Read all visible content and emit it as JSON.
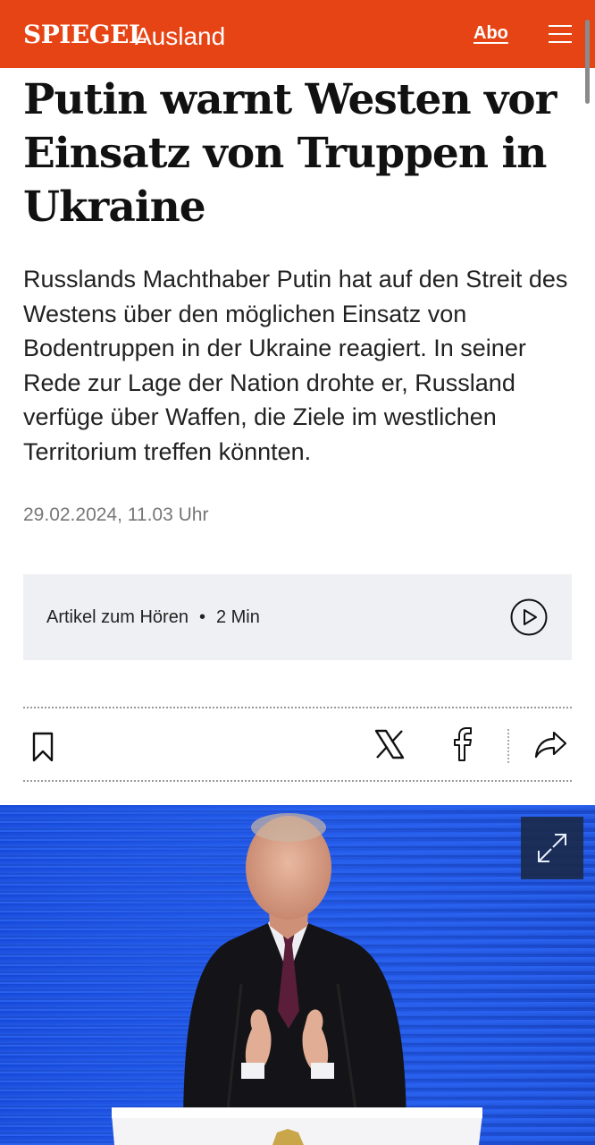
{
  "header": {
    "brand": "SPIEGEL",
    "section": "Ausland",
    "abo_label": "Abo",
    "menu_icon": "hamburger-menu-icon",
    "background": "#e64415"
  },
  "article": {
    "headline": "Putin warnt Westen vor Einsatz von Truppen in Ukraine",
    "teaser": "Russlands Machthaber Putin hat auf den Streit des Westens über den möglichen Einsatz von Bodentruppen in der Ukraine reagiert. In seiner Rede zur Lage der Nation drohte er, Russland verfüge über Waffen, die Ziele im westlichen Territorium treffen könnten.",
    "date": "29.02.2024, 11.03 Uhr"
  },
  "audio": {
    "label": "Artikel zum Hören",
    "separator": "•",
    "duration": "2 Min",
    "icon": "play-circle-icon"
  },
  "actions": {
    "icons": [
      "bookmark-icon",
      "x-logo-icon",
      "facebook-icon",
      "share-icon"
    ]
  },
  "image": {
    "expand_icon": "expand-icon"
  }
}
